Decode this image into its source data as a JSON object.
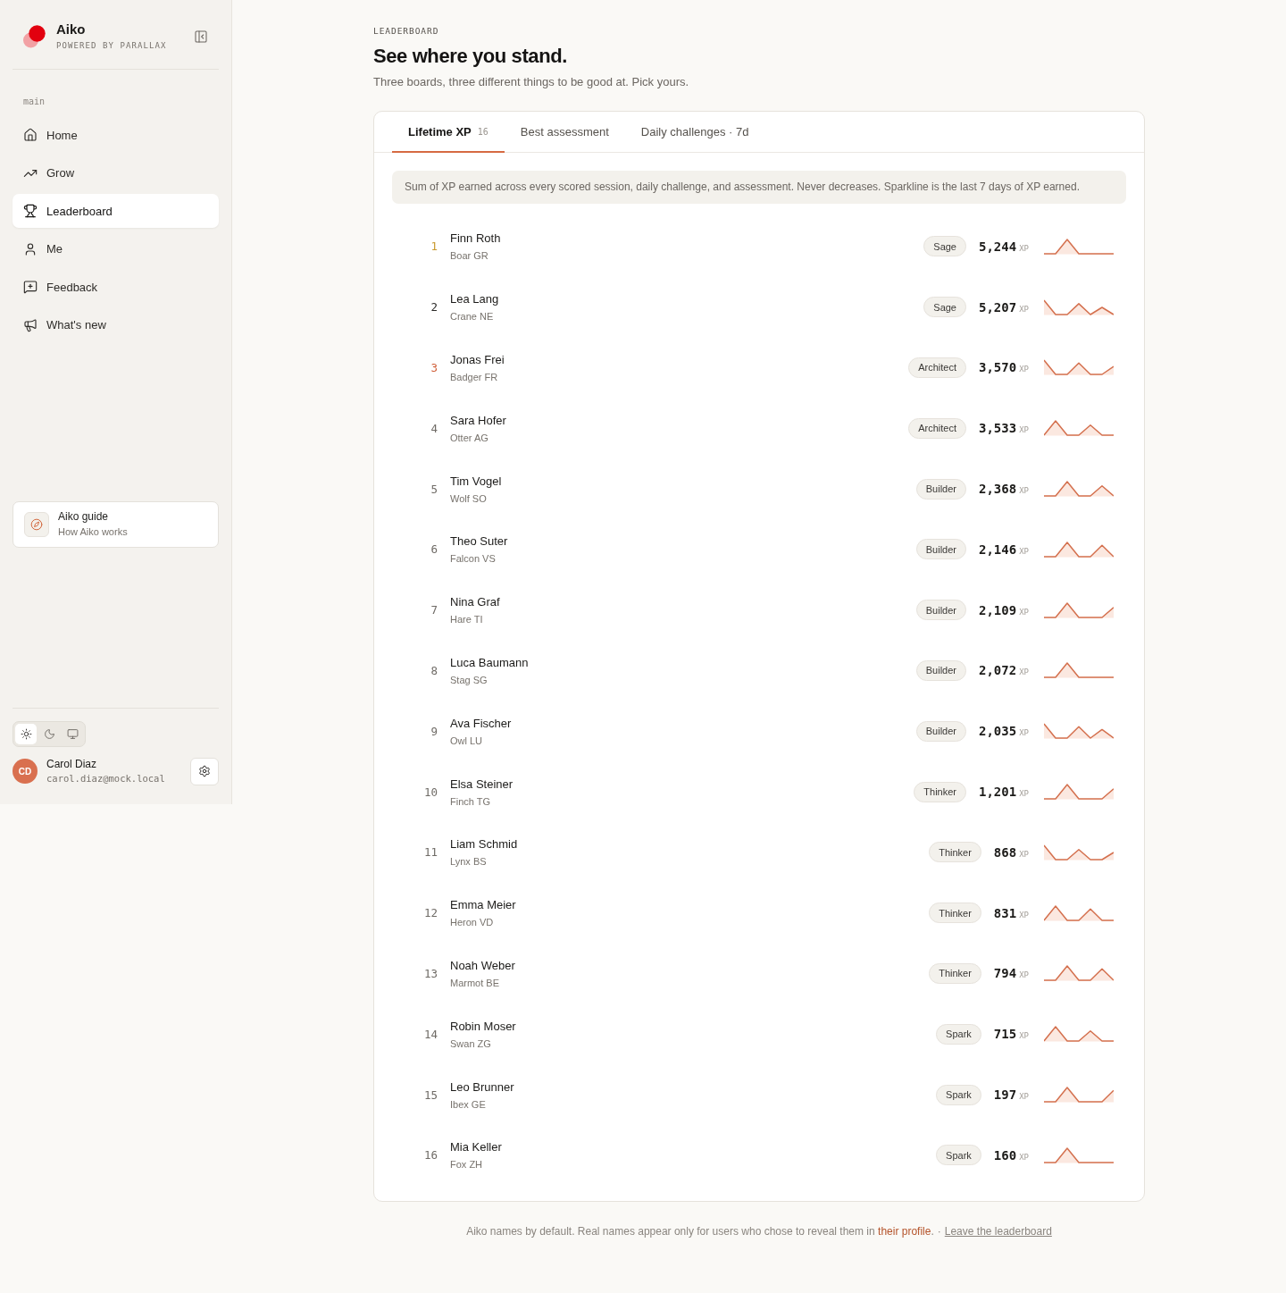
{
  "sidebar": {
    "brand": {
      "name": "Aiko",
      "tagline": "POWERED BY PARALLAX"
    },
    "section_label": "main",
    "nav_items": [
      {
        "label": "Home",
        "selected": false
      },
      {
        "label": "Grow",
        "selected": false
      },
      {
        "label": "Leaderboard",
        "selected": true
      },
      {
        "label": "Me",
        "selected": false
      },
      {
        "label": "Feedback",
        "selected": false
      },
      {
        "label": "What's new",
        "selected": false
      }
    ],
    "guide": {
      "title": "Aiko guide",
      "subtitle": "How Aiko works"
    },
    "theme_options": [
      {
        "selected": true
      },
      {
        "selected": false
      },
      {
        "selected": false
      }
    ],
    "user": {
      "initials": "CD",
      "name": "Carol Diaz",
      "email": "carol.diaz@mock.local"
    }
  },
  "header": {
    "eyebrow": "LEADERBOARD",
    "title": "See where you stand.",
    "subtitle": "Three boards, three different things to be good at. Pick yours."
  },
  "tabs": [
    {
      "label": "Lifetime XP",
      "count": "16",
      "selected": true
    },
    {
      "label": "Best assessment",
      "selected": false
    },
    {
      "label": "Daily challenges · 7d",
      "selected": false
    }
  ],
  "description": "Sum of XP earned across every scored session, daily challenge, and assessment. Never decreases. Sparkline is the last 7 days of XP earned.",
  "rows": [
    {
      "rank": "1",
      "color": "#c99a2e",
      "name": "Finn Roth",
      "team": "Boar GR",
      "tier": "Sage",
      "xp": "5,244",
      "unit": "XP"
    },
    {
      "rank": "2",
      "color": "#2b2a28",
      "name": "Lea Lang",
      "team": "Crane NE",
      "tier": "Sage",
      "xp": "5,207",
      "unit": "XP"
    },
    {
      "rank": "3",
      "color": "#d0603a",
      "name": "Jonas Frei",
      "team": "Badger FR",
      "tier": "Architect",
      "xp": "3,570",
      "unit": "XP"
    },
    {
      "rank": "4",
      "color": "#6f6b66",
      "name": "Sara Hofer",
      "team": "Otter AG",
      "tier": "Architect",
      "xp": "3,533",
      "unit": "XP"
    },
    {
      "rank": "5",
      "color": "#6f6b66",
      "name": "Tim Vogel",
      "team": "Wolf SO",
      "tier": "Builder",
      "xp": "2,368",
      "unit": "XP"
    },
    {
      "rank": "6",
      "color": "#6f6b66",
      "name": "Theo Suter",
      "team": "Falcon VS",
      "tier": "Builder",
      "xp": "2,146",
      "unit": "XP"
    },
    {
      "rank": "7",
      "color": "#6f6b66",
      "name": "Nina Graf",
      "team": "Hare TI",
      "tier": "Builder",
      "xp": "2,109",
      "unit": "XP"
    },
    {
      "rank": "8",
      "color": "#6f6b66",
      "name": "Luca Baumann",
      "team": "Stag SG",
      "tier": "Builder",
      "xp": "2,072",
      "unit": "XP"
    },
    {
      "rank": "9",
      "color": "#6f6b66",
      "name": "Ava Fischer",
      "team": "Owl LU",
      "tier": "Builder",
      "xp": "2,035",
      "unit": "XP"
    },
    {
      "rank": "10",
      "color": "#6f6b66",
      "name": "Elsa Steiner",
      "team": "Finch TG",
      "tier": "Thinker",
      "xp": "1,201",
      "unit": "XP"
    },
    {
      "rank": "11",
      "color": "#6f6b66",
      "name": "Liam Schmid",
      "team": "Lynx BS",
      "tier": "Thinker",
      "xp": "868",
      "unit": "XP"
    },
    {
      "rank": "12",
      "color": "#6f6b66",
      "name": "Emma Meier",
      "team": "Heron VD",
      "tier": "Thinker",
      "xp": "831",
      "unit": "XP"
    },
    {
      "rank": "13",
      "color": "#6f6b66",
      "name": "Noah Weber",
      "team": "Marmot BE",
      "tier": "Thinker",
      "xp": "794",
      "unit": "XP"
    },
    {
      "rank": "14",
      "color": "#6f6b66",
      "name": "Robin Moser",
      "team": "Swan ZG",
      "tier": "Spark",
      "xp": "715",
      "unit": "XP"
    },
    {
      "rank": "15",
      "color": "#6f6b66",
      "name": "Leo Brunner",
      "team": "Ibex GE",
      "tier": "Spark",
      "xp": "197",
      "unit": "XP"
    },
    {
      "rank": "16",
      "color": "#6f6b66",
      "name": "Mia Keller",
      "team": "Fox ZH",
      "tier": "Spark",
      "xp": "160",
      "unit": "XP"
    }
  ],
  "footer": {
    "note": "Aiko names by default. Real names appear only for users who chose to reveal them in",
    "profile_link": "their profile",
    "note_end": ".",
    "separator": "·",
    "leave_link": "Leave the leaderboard"
  }
}
